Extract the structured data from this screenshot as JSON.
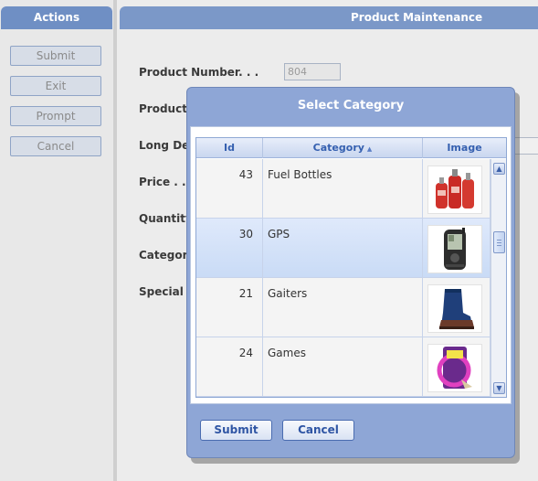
{
  "actions": {
    "title": "Actions",
    "buttons": [
      {
        "label": "Submit"
      },
      {
        "label": "Exit"
      },
      {
        "label": "Prompt"
      },
      {
        "label": "Cancel"
      }
    ]
  },
  "main": {
    "title": "Product Maintenance",
    "fields": [
      {
        "label": "Product Number. . .",
        "value": "804"
      },
      {
        "label": "Product"
      },
      {
        "label": "Long De"
      },
      {
        "label": "Price . ."
      },
      {
        "label": "Quantity"
      },
      {
        "label": "Categor"
      },
      {
        "label": "Special I"
      }
    ]
  },
  "dialog": {
    "title": "Select Category",
    "columns": [
      {
        "label": "Id"
      },
      {
        "label": "Category",
        "sort_indicator": "▲"
      },
      {
        "label": "Image"
      }
    ],
    "rows": [
      {
        "id": "43",
        "category": "Fuel Bottles",
        "image_icon": "fuel-bottles-image",
        "selected": false
      },
      {
        "id": "30",
        "category": "GPS",
        "image_icon": "gps-device-image",
        "selected": true
      },
      {
        "id": "21",
        "category": "Gaiters",
        "image_icon": "gaiter-boot-image",
        "selected": false
      },
      {
        "id": "24",
        "category": "Games",
        "image_icon": "flying-ring-game-image",
        "selected": false
      }
    ],
    "scroll_up": "▲",
    "scroll_down": "▼",
    "submit_label": "Submit",
    "cancel_label": "Cancel"
  },
  "colors": {
    "header_blue": "#6f8fc4",
    "dialog_blue": "#8ea6d6",
    "selected_row": "#c9dbf6",
    "button_text": "#2f55a4"
  }
}
